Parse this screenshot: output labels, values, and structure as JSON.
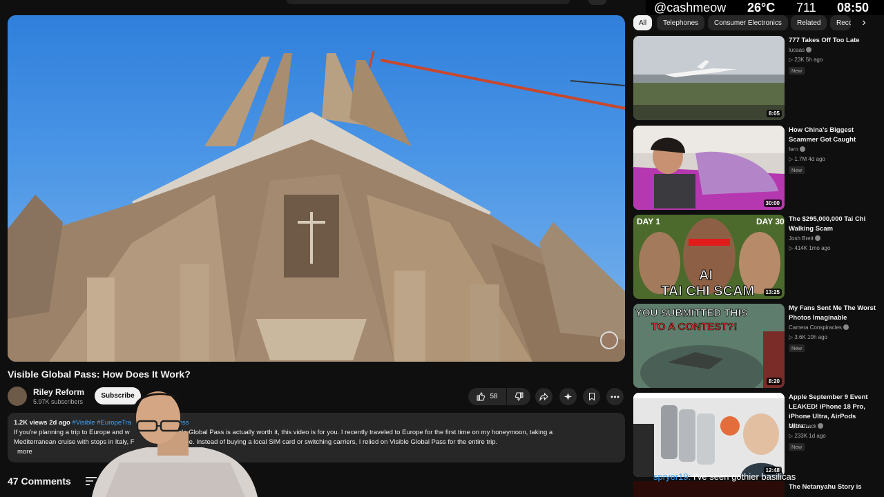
{
  "overlay": {
    "handle": "@cashmeow",
    "temp": "26°C",
    "count": "711",
    "time": "08:50"
  },
  "video": {
    "title": "Visible Global Pass: How Does It Work?",
    "channel": "Riley Reform",
    "subscribers": "5.97K subscribers",
    "subscribe_label": "Subscribe",
    "likes": "58"
  },
  "description": {
    "meta": "1.2K views  2d ago",
    "tags": "#Visible #EuropeTra",
    "tags_tail": "eless",
    "line1a": "If you're planning a trip to Europe and w",
    "line1b": "er Visible Global Pass is actually worth it, this video is for you. I recently traveled to Europe for the first time on my honeymoon, taking a",
    "line2a": "Mediterranean cruise with stops in Italy, F",
    "line2b": "nd Greece. Instead of buying a local SIM card or switching carriers, I relied on Visible Global Pass for the entire trip.",
    "more": "more"
  },
  "comments_label": "47 Comments",
  "chips": [
    "All",
    "Telephones",
    "Consumer Electronics",
    "Related",
    "Reco"
  ],
  "recommendations": [
    {
      "title": "777 Takes Off Too Late",
      "channel": "lucaas",
      "views": "▷ 23K  5h ago",
      "badge": "New",
      "duration": "8:05"
    },
    {
      "title": "How China's Biggest Scammer Got Caught",
      "channel": "fern",
      "views": "▷ 1.7M  4d ago",
      "badge": "New",
      "duration": "30:00"
    },
    {
      "title": "The $295,000,000 Tai Chi Walking Scam",
      "channel": "Josh Brett",
      "views": "▷ 414K  1mo ago",
      "badge": "",
      "duration": "13:25"
    },
    {
      "title": "My Fans Sent Me The Worst Photos Imaginable",
      "channel": "Camera Conspiracies",
      "views": "▷ 3.6K  10h ago",
      "badge": "New",
      "duration": "8:20"
    },
    {
      "title": "Apple September 9 Event LEAKED! iPhone 18 Pro, iPhone Ultra, AirPods Ultra...",
      "channel": "AppleTrack",
      "views": "▷ 233K  1d ago",
      "badge": "New",
      "duration": "12:48"
    },
    {
      "title": "The Netanyahu Story is",
      "channel": "",
      "views": "",
      "badge": "",
      "duration": ""
    }
  ],
  "thumb_text": {
    "day1": "DAY 1",
    "day30": "DAY 30",
    "ai": "AI",
    "scam": "TAI CHI SCAM",
    "contest1": "YOU SUBMITTED THIS",
    "contest2": "TO A CONTEST?!"
  },
  "chat": {
    "user": "spryer19:",
    "message": "I've seen gothier basilicas"
  }
}
